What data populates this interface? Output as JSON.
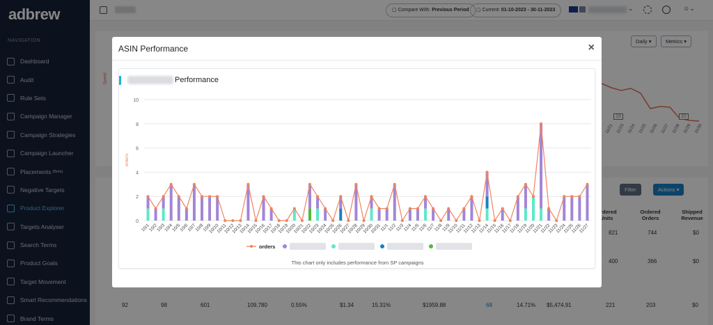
{
  "sidebar": {
    "logo": "adbrew",
    "heading": "NAVIGATION",
    "items": [
      {
        "label": "Dashboard",
        "icon": "dashboard-icon"
      },
      {
        "label": "Audit",
        "icon": "pulse-icon"
      },
      {
        "label": "Rule Sets",
        "icon": "rules-icon"
      },
      {
        "label": "Campaign Manager",
        "icon": "flag-icon"
      },
      {
        "label": "Campaign Strategies",
        "icon": "refresh-icon"
      },
      {
        "label": "Campaign Launcher",
        "icon": "send-icon"
      },
      {
        "label": "Placements",
        "sup": "(Beta)",
        "icon": "layers-icon"
      },
      {
        "label": "Negative Targets",
        "icon": "minus-circle-icon"
      },
      {
        "label": "Product Explorer",
        "icon": "cube-icon",
        "active": true
      },
      {
        "label": "Targets Analyser",
        "icon": "target-icon"
      },
      {
        "label": "Search Terms",
        "icon": "search-icon"
      },
      {
        "label": "Product Goals",
        "icon": "goal-icon"
      },
      {
        "label": "Target Movement",
        "icon": "movement-icon"
      },
      {
        "label": "Smart Recommendations",
        "icon": "bulb-icon"
      },
      {
        "label": "Brand Terms",
        "icon": "tag-icon"
      }
    ]
  },
  "header": {
    "compare_label": "Compare With:",
    "compare_value": "Previous Period",
    "current_label": "Current:",
    "current_value": "01-10-2023 - 30-11-2023"
  },
  "background": {
    "daily_btn": "Daily",
    "metrics_btn": "Metrics",
    "filter_btn": "Filter",
    "actions_btn": "Actions",
    "mini_labels": [
      "19",
      "32"
    ],
    "spend_axis": "Spend",
    "mini_dates": [
      "11/21",
      "11/23",
      "11/24",
      "11/25",
      "11/26",
      "11/27",
      "11/28",
      "11/29",
      "11/30"
    ],
    "col_headers": [
      "Ordered Units",
      "Ordered Orders",
      "Shipped Revenue"
    ],
    "row1": [
      "821",
      "744",
      "$0"
    ],
    "row2": [
      "400",
      "366",
      "$0"
    ],
    "bottom_row": [
      "92",
      "98",
      "601",
      "109,780",
      "0.55%",
      "$1.34",
      "15.31%",
      "$1959.88",
      "68",
      "14.71%",
      "$5,474.91",
      "221",
      "203",
      "$0"
    ]
  },
  "modal": {
    "title": "ASIN Performance",
    "card_title": "Performance",
    "note": "This chart only includes performance from SP campaigns"
  },
  "colors": {
    "orders_line": "#f0845c",
    "series_purple": "#a285d6",
    "series_teal": "#5ee8c8",
    "series_blue": "#1a7fc4",
    "series_green": "#4dbb3a",
    "axis_label": "#f0845c"
  },
  "chart_data": {
    "type": "bar",
    "stacked": true,
    "title": "Performance",
    "ylabel": "orders",
    "ylim": [
      0,
      10
    ],
    "yticks": [
      0,
      2,
      4,
      6,
      8,
      10
    ],
    "grid": true,
    "legend_position": "bottom",
    "categories": [
      "10/1",
      "10/2",
      "10/3",
      "10/4",
      "10/5",
      "10/6",
      "10/7",
      "10/8",
      "10/9",
      "10/10",
      "10/11",
      "10/12",
      "10/13",
      "10/14",
      "10/15",
      "10/16",
      "10/17",
      "10/18",
      "10/19",
      "10/20",
      "10/21",
      "10/22",
      "10/23",
      "10/24",
      "10/25",
      "10/26",
      "10/27",
      "10/28",
      "10/29",
      "10/30",
      "10/31",
      "11/1",
      "11/2",
      "11/3",
      "11/4",
      "11/5",
      "11/6",
      "11/7",
      "11/8",
      "11/9",
      "11/10",
      "11/11",
      "11/12",
      "11/13",
      "11/14",
      "11/15",
      "11/16",
      "11/17",
      "11/18",
      "11/19",
      "11/20",
      "11/21",
      "11/22",
      "11/23",
      "11/24",
      "11/25",
      "11/26",
      "11/27"
    ],
    "series": [
      {
        "name": "orders",
        "kind": "line",
        "values": [
          2,
          1,
          2,
          3,
          2,
          1,
          3,
          2,
          2,
          2,
          0,
          0,
          0,
          3,
          0,
          2,
          1,
          0,
          0,
          1,
          0,
          3,
          2,
          1,
          0,
          2,
          0,
          3,
          0,
          2,
          1,
          1,
          3,
          0,
          1,
          1,
          2,
          1,
          0,
          1,
          0,
          1,
          2,
          0,
          4,
          0,
          1,
          0,
          2,
          3,
          2,
          8,
          1,
          0,
          2,
          2,
          2,
          3
        ]
      },
      {
        "kind": "bar",
        "values": [
          1,
          1,
          1,
          3,
          2,
          1,
          3,
          2,
          2,
          2,
          0,
          0,
          0,
          3,
          0,
          2,
          1,
          0,
          0,
          0,
          0,
          2,
          1,
          1,
          0,
          1,
          0,
          3,
          0,
          1,
          1,
          1,
          3,
          0,
          1,
          1,
          1,
          1,
          0,
          1,
          0,
          1,
          2,
          0,
          2,
          0,
          1,
          0,
          2,
          2,
          0,
          7,
          1,
          0,
          2,
          2,
          2,
          3
        ]
      },
      {
        "kind": "bar",
        "values": [
          1,
          0,
          1,
          0,
          0,
          0,
          0,
          0,
          0,
          0,
          0,
          0,
          0,
          0,
          0,
          0,
          0,
          0,
          0,
          1,
          0,
          0,
          1,
          0,
          0,
          0,
          0,
          0,
          0,
          1,
          0,
          0,
          0,
          0,
          0,
          0,
          1,
          0,
          0,
          0,
          0,
          0,
          0,
          0,
          1,
          0,
          0,
          0,
          0,
          1,
          2,
          1,
          0,
          0,
          0,
          0,
          0,
          0
        ]
      },
      {
        "kind": "bar",
        "values": [
          0,
          0,
          0,
          0,
          0,
          0,
          0,
          0,
          0,
          0,
          0,
          0,
          0,
          0,
          0,
          0,
          0,
          0,
          0,
          0,
          0,
          0,
          0,
          0,
          0,
          1,
          0,
          0,
          0,
          0,
          0,
          0,
          0,
          0,
          0,
          0,
          0,
          0,
          0,
          0,
          0,
          0,
          0,
          0,
          1,
          0,
          0,
          0,
          0,
          0,
          0,
          0,
          0,
          0,
          0,
          0,
          0,
          0
        ]
      },
      {
        "kind": "bar",
        "values": [
          0,
          0,
          0,
          0,
          0,
          0,
          0,
          0,
          0,
          0,
          0,
          0,
          0,
          0,
          0,
          0,
          0,
          0,
          0,
          0,
          0,
          1,
          0,
          0,
          0,
          0,
          0,
          0,
          0,
          0,
          0,
          0,
          0,
          0,
          0,
          0,
          0,
          0,
          0,
          0,
          0,
          0,
          0,
          0,
          0,
          0,
          0,
          0,
          0,
          0,
          0,
          0,
          0,
          0,
          0,
          0,
          0,
          0
        ]
      }
    ]
  }
}
